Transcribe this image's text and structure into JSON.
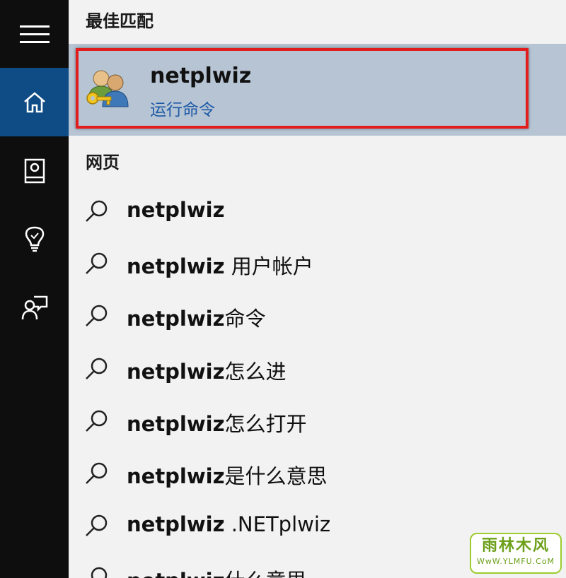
{
  "nav": {
    "items": [
      {
        "icon": "hamburger-icon"
      },
      {
        "icon": "home-icon",
        "active": true
      },
      {
        "icon": "notebook-icon"
      },
      {
        "icon": "lightbulb-icon"
      },
      {
        "icon": "feedback-icon"
      }
    ],
    "active_color": "#0f4b85",
    "rail_color": "#0e0e0e"
  },
  "best_match": {
    "heading": "最佳匹配",
    "app_name": "netplwiz",
    "app_subtitle": "运行命令",
    "icon": "user-accounts-keys-icon",
    "highlight_color": "#b6c4d3",
    "outline_color": "#e11d1d"
  },
  "web": {
    "heading": "网页",
    "suggestions": [
      {
        "bold": "netplwiz",
        "rest": ""
      },
      {
        "bold": "netplwiz",
        "rest": " 用户帐户"
      },
      {
        "bold": "netplwiz",
        "rest": "命令"
      },
      {
        "bold": "netplwiz",
        "rest": "怎么进"
      },
      {
        "bold": "netplwiz",
        "rest": "怎么打开"
      },
      {
        "bold": "netplwiz",
        "rest": "是什么意思"
      },
      {
        "bold": "netplwiz",
        "rest": " .NETplwiz"
      },
      {
        "bold": "netplwiz",
        "rest": "什么意思"
      }
    ]
  },
  "watermark": {
    "title": "雨林木风",
    "url": "WwW.YLMFU.CoM"
  }
}
